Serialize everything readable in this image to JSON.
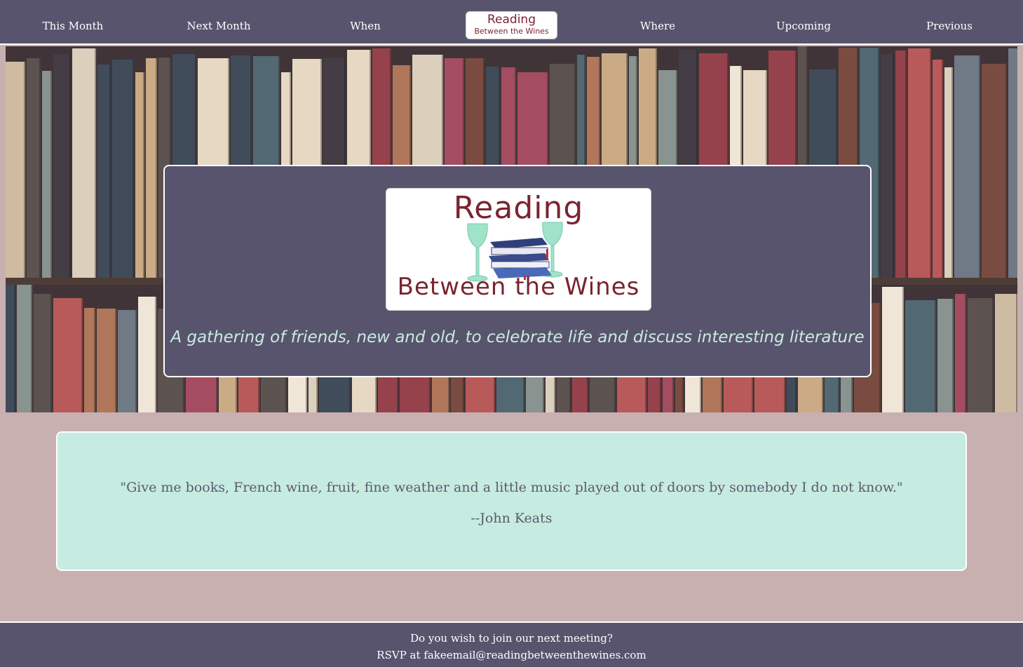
{
  "nav": {
    "items": [
      {
        "label": "This Month"
      },
      {
        "label": "Next Month"
      },
      {
        "label": "When"
      },
      {
        "label": "Where"
      },
      {
        "label": "Upcoming"
      },
      {
        "label": "Previous"
      }
    ],
    "logo": {
      "line1": "Reading",
      "line2": "Between the Wines"
    }
  },
  "hero": {
    "logo": {
      "line1": "Reading",
      "line2": "Between the Wines"
    },
    "tagline": "A gathering of friends, new and old, to celebrate life and discuss interesting literature"
  },
  "quote": {
    "text": "\"Give me books, French wine, fruit, fine weather and a little music played out of doors by somebody I do not know.\"",
    "author": "--John Keats"
  },
  "footer": {
    "line1": "Do you wish to join our next meeting?",
    "rsvp_prefix": "RSVP at",
    "email": "fakeemail@readingbetweenthewines.com"
  },
  "colors": {
    "nav_bg": "#59546e",
    "page_bg": "#c8b0b0",
    "quote_bg": "#c6ebe0",
    "tagline": "#c8ecdf",
    "logo_text": "#7a2430"
  }
}
